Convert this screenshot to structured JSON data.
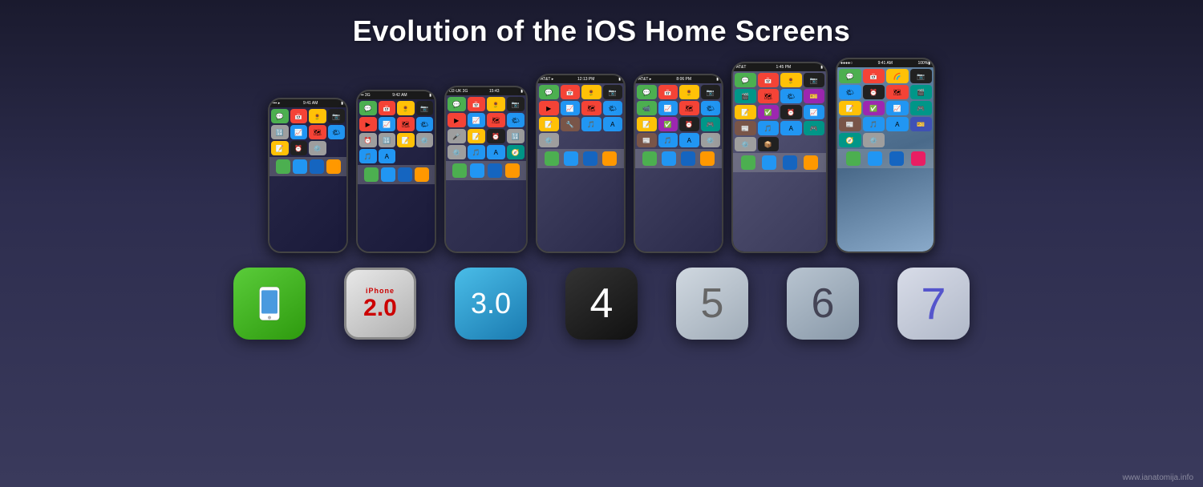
{
  "title": "Evolution of the iOS Home Screens",
  "watermark": "www.ianatomija.info",
  "phones": [
    {
      "id": "ios1",
      "status": "9:41 AM",
      "label": "iOS 1"
    },
    {
      "id": "ios2",
      "status": "9:42 AM",
      "label": "iPhone 2.0"
    },
    {
      "id": "ios3",
      "status": "15:43",
      "label": "iPhone 3.0"
    },
    {
      "id": "ios4",
      "status": "12:13 PM",
      "label": "iOS 4"
    },
    {
      "id": "ios5",
      "status": "8:06 PM",
      "label": "iOS 5"
    },
    {
      "id": "ios6",
      "status": "1:45 PM",
      "label": "iOS 6"
    },
    {
      "id": "ios7",
      "status": "9:41 AM",
      "label": "iOS 7"
    }
  ],
  "badges": [
    {
      "type": "phone-icon",
      "label": "iOS 1"
    },
    {
      "type": "number",
      "number": "2.0",
      "sub": "iPhone",
      "label": "iPhone 2.0"
    },
    {
      "type": "number",
      "number": "3.0",
      "label": "iOS 3"
    },
    {
      "type": "number",
      "number": "4",
      "label": "iOS 4"
    },
    {
      "type": "number",
      "number": "5",
      "label": "iOS 5"
    },
    {
      "type": "number",
      "number": "6",
      "label": "iOS 6"
    },
    {
      "type": "number",
      "number": "7",
      "label": "iOS 7"
    }
  ]
}
